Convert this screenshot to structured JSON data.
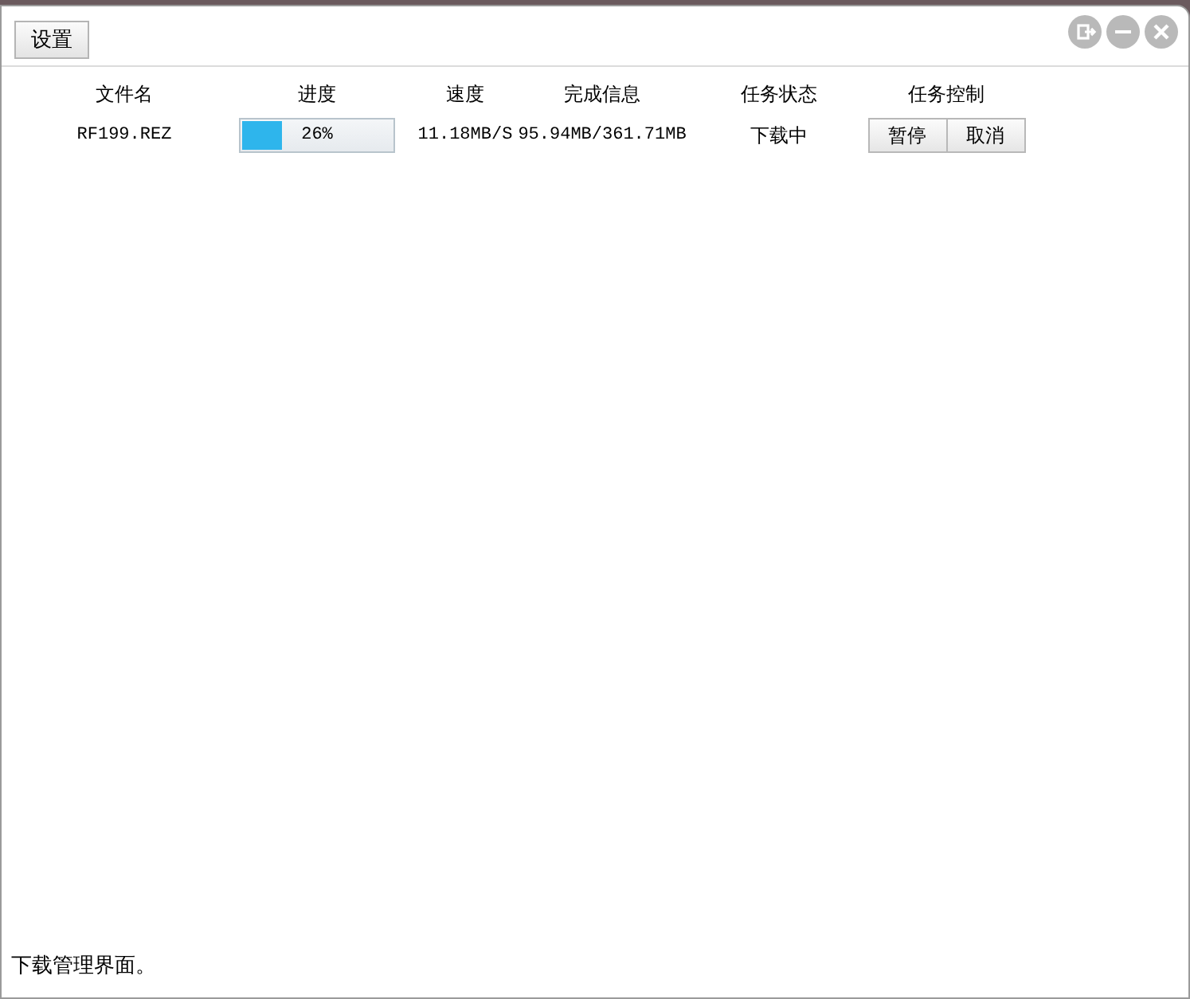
{
  "toolbar": {
    "settings_button": "设置"
  },
  "table": {
    "columns": [
      "文件名",
      "进度",
      "速度",
      "完成信息",
      "任务状态",
      "任务控制"
    ],
    "rows": [
      {
        "file_name": "RF199.REZ",
        "progress": {
          "level": 0.26,
          "text": "26%"
        },
        "speed": "11.18MB/S",
        "completed": "95.94MB/361.71MB",
        "status": "下载中",
        "controls": [
          "暂停",
          "取消"
        ]
      }
    ]
  },
  "status_bar": "下载管理界面。"
}
